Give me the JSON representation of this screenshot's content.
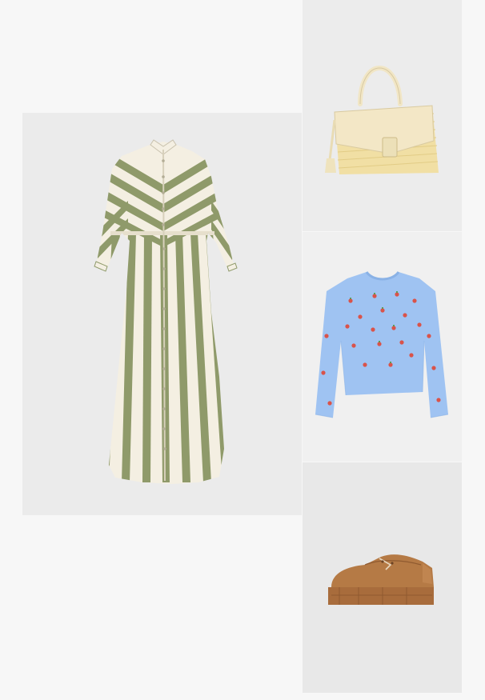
{
  "outfit": {
    "items": [
      {
        "name": "dress",
        "icon": "striped-shirt-dress-image",
        "colors": {
          "stripe": "#8f9a6a",
          "base": "#f4efe2"
        }
      },
      {
        "name": "bag",
        "icon": "straw-handbag-image",
        "colors": {
          "flap": "#f3e7c6",
          "straw": "#f1dfa4"
        }
      },
      {
        "name": "sweater",
        "icon": "strawberry-sweater-image",
        "colors": {
          "knit": "#9fc3f2",
          "berry": "#d9534a"
        }
      },
      {
        "name": "shoe",
        "icon": "brown-loafer-image",
        "colors": {
          "leather": "#b57a45",
          "sole": "#a86c3c"
        }
      }
    ]
  }
}
